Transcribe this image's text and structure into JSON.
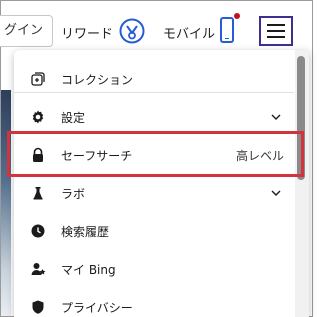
{
  "header": {
    "signin_label": "グイン",
    "rewards_label": "リワード",
    "mobile_label": "モバイル"
  },
  "menu": {
    "items": [
      {
        "label": "コレクション",
        "value": "",
        "icon": "collections-icon"
      },
      {
        "label": "設定",
        "value": "",
        "icon": "gear-icon",
        "expandable": true
      },
      {
        "label": "セーフサーチ",
        "value": "高レベル",
        "icon": "lock-icon"
      },
      {
        "label": "ラボ",
        "value": "",
        "icon": "flask-icon",
        "expandable": true
      },
      {
        "label": "検索履歴",
        "value": "",
        "icon": "clock-icon"
      },
      {
        "label": "マイ Bing",
        "value": "",
        "icon": "user-star-icon"
      },
      {
        "label": "プライバシー",
        "value": "",
        "icon": "shield-icon"
      }
    ]
  },
  "colors": {
    "highlight": "#d1343c",
    "accent": "#2a5bd7",
    "menu_button_border": "#3b2f8f",
    "notification": "#c50f1f"
  }
}
